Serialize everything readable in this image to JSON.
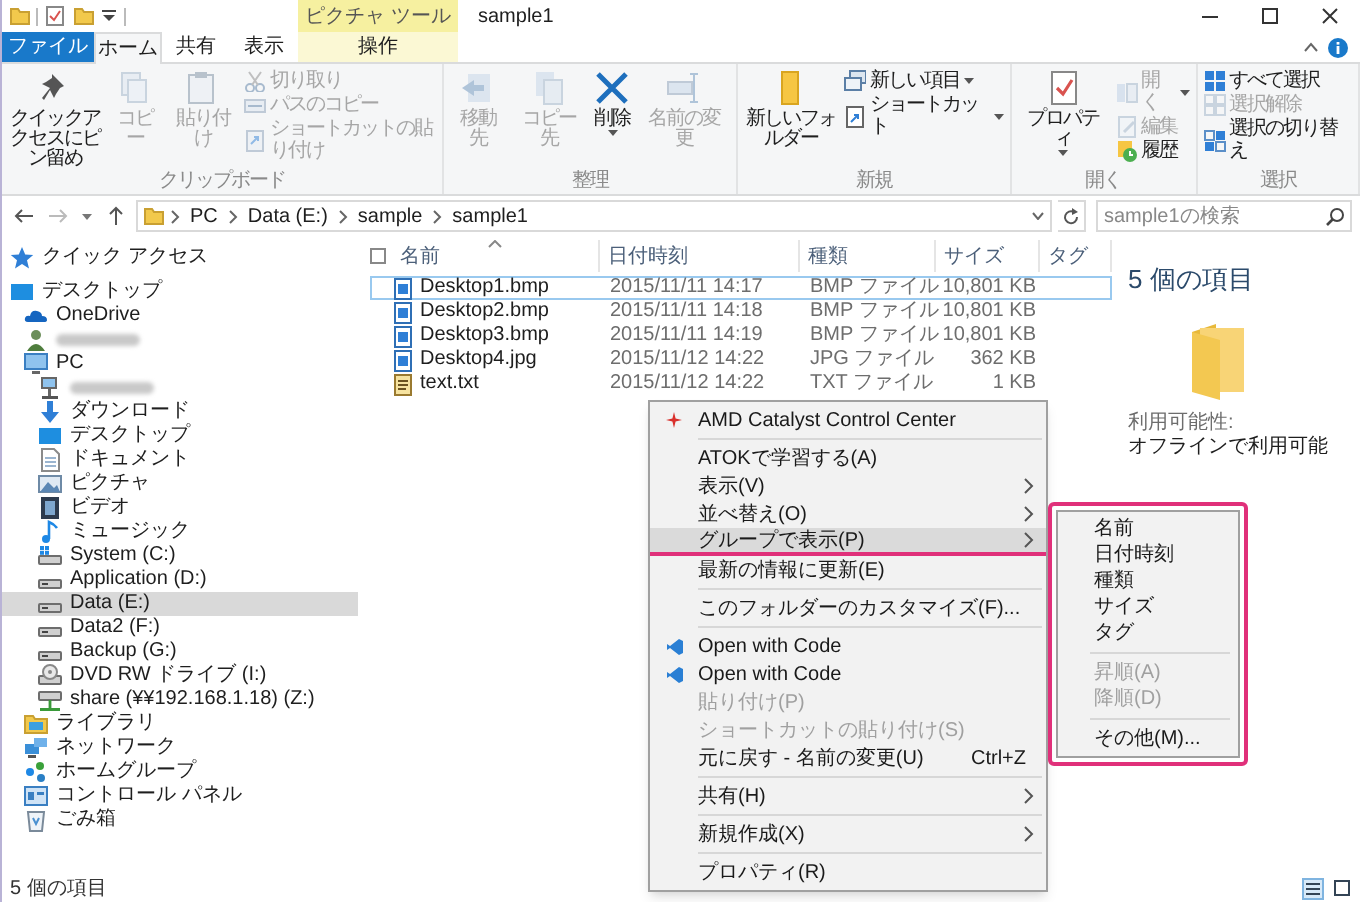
{
  "title_bar": {
    "context_tab_group": "ピクチャ ツール",
    "title": "sample1"
  },
  "tabs": [
    {
      "label": "ファイル",
      "kind": "file",
      "selected": false
    },
    {
      "label": "ホーム",
      "kind": "normal",
      "selected": true
    },
    {
      "label": "共有",
      "kind": "normal",
      "selected": false
    },
    {
      "label": "表示",
      "kind": "normal",
      "selected": false
    },
    {
      "label": "操作",
      "kind": "contextual",
      "selected": false
    }
  ],
  "ribbon": [
    {
      "label": "クリップボード",
      "buttons": [
        {
          "kind": "large",
          "label": "クイックアクセスにピン留め",
          "disabled": false
        },
        {
          "kind": "large",
          "label": "コピー",
          "disabled": true
        },
        {
          "kind": "large",
          "label": "貼り付け",
          "disabled": true
        },
        {
          "kind": "small",
          "label": "切り取り",
          "disabled": true
        },
        {
          "kind": "small",
          "label": "パスのコピー",
          "disabled": true
        },
        {
          "kind": "small",
          "label": "ショートカットの貼り付け",
          "disabled": true
        }
      ]
    },
    {
      "label": "整理",
      "buttons": [
        {
          "kind": "large",
          "label": "移動先",
          "disabled": true
        },
        {
          "kind": "large",
          "label": "コピー先",
          "disabled": true
        },
        {
          "kind": "large",
          "label": "削除",
          "disabled": false,
          "dropdown": true
        },
        {
          "kind": "large",
          "label": "名前の変更",
          "disabled": true
        }
      ]
    },
    {
      "label": "新規",
      "buttons": [
        {
          "kind": "large",
          "label": "新しいフォルダー",
          "disabled": false
        },
        {
          "kind": "small",
          "label": "新しい項目",
          "disabled": false,
          "dropdown": true
        },
        {
          "kind": "small",
          "label": "ショートカット",
          "disabled": false,
          "dropdown": true
        }
      ]
    },
    {
      "label": "開く",
      "buttons": [
        {
          "kind": "large",
          "label": "プロパティ",
          "disabled": false,
          "dropdown": true
        },
        {
          "kind": "small",
          "label": "開く",
          "disabled": true,
          "dropdown": true
        },
        {
          "kind": "small",
          "label": "編集",
          "disabled": true
        },
        {
          "kind": "small",
          "label": "履歴",
          "disabled": false
        }
      ]
    },
    {
      "label": "選択",
      "buttons": [
        {
          "kind": "small",
          "label": "すべて選択",
          "disabled": false
        },
        {
          "kind": "small",
          "label": "選択解除",
          "disabled": true
        },
        {
          "kind": "small",
          "label": "選択の切り替え",
          "disabled": false
        }
      ]
    }
  ],
  "address_bar": {
    "path": [
      "PC",
      "Data (E:)",
      "sample",
      "sample1"
    ],
    "search": {
      "placeholder": "sample1の検索"
    }
  },
  "navigation": [
    {
      "label": "クイック アクセス",
      "kind": "item",
      "selected": false
    },
    {
      "label": "デスクトップ",
      "kind": "item",
      "selected": false,
      "children": [
        {
          "label": "OneDrive",
          "kind": "item",
          "selected": false
        },
        {
          "kind": "blurred",
          "selected": false
        },
        {
          "label": "PC",
          "kind": "item",
          "selected": false,
          "children": [
            {
              "kind": "blurred",
              "selected": false
            },
            {
              "label": "ダウンロード",
              "kind": "item",
              "selected": false
            },
            {
              "label": "デスクトップ",
              "kind": "item",
              "selected": false
            },
            {
              "label": "ドキュメント",
              "kind": "item",
              "selected": false
            },
            {
              "label": "ピクチャ",
              "kind": "item",
              "selected": false
            },
            {
              "label": "ビデオ",
              "kind": "item",
              "selected": false
            },
            {
              "label": "ミュージック",
              "kind": "item",
              "selected": false
            },
            {
              "label": "System (C:)",
              "kind": "item",
              "selected": false
            },
            {
              "label": "Application (D:)",
              "kind": "item",
              "selected": false
            },
            {
              "label": "Data (E:)",
              "kind": "item",
              "selected": true
            },
            {
              "label": "Data2 (F:)",
              "kind": "item",
              "selected": false
            },
            {
              "label": "Backup (G:)",
              "kind": "item",
              "selected": false
            },
            {
              "label": "DVD RW ドライブ (I:)",
              "kind": "item",
              "selected": false
            },
            {
              "label": "share (¥¥192.168.1.18) (Z:)",
              "kind": "item",
              "selected": false
            }
          ]
        },
        {
          "label": "ライブラリ",
          "kind": "item",
          "selected": false
        },
        {
          "label": "ネットワーク",
          "kind": "item",
          "selected": false
        },
        {
          "label": "ホームグループ",
          "kind": "item",
          "selected": false
        },
        {
          "label": "コントロール パネル",
          "kind": "item",
          "selected": false
        },
        {
          "label": "ごみ箱",
          "kind": "item",
          "selected": false
        }
      ]
    }
  ],
  "file_list": {
    "select_all_checked": false,
    "columns": [
      {
        "label": "名前",
        "sorted": true
      },
      {
        "label": "日付時刻",
        "sorted": false
      },
      {
        "label": "種類",
        "sorted": false
      },
      {
        "label": "サイズ",
        "sorted": false
      },
      {
        "label": "タグ",
        "sorted": false
      }
    ],
    "rows": [
      {
        "name": "Desktop1.bmp",
        "date": "2015/11/11 14:17",
        "type": "BMP ファイル",
        "size": "10,801 KB",
        "kind": "image",
        "focused": true
      },
      {
        "name": "Desktop2.bmp",
        "date": "2015/11/11 14:18",
        "type": "BMP ファイル",
        "size": "10,801 KB",
        "kind": "image",
        "focused": false
      },
      {
        "name": "Desktop3.bmp",
        "date": "2015/11/11 14:19",
        "type": "BMP ファイル",
        "size": "10,801 KB",
        "kind": "image",
        "focused": false
      },
      {
        "name": "Desktop4.jpg",
        "date": "2015/11/12 14:22",
        "type": "JPG ファイル",
        "size": "362 KB",
        "kind": "image",
        "focused": false
      },
      {
        "name": "text.txt",
        "date": "2015/11/12 14:22",
        "type": "TXT ファイル",
        "size": "1 KB",
        "kind": "text",
        "focused": false
      }
    ]
  },
  "details_pane": {
    "summary": "5 個の項目",
    "availability_label": "利用可能性:",
    "availability_value": "オフラインで利用可能"
  },
  "context_menu": {
    "sections": [
      [
        {
          "label": "AMD Catalyst Control Center",
          "selected": false,
          "disabled": false,
          "submenu": false
        }
      ],
      [
        {
          "label": "ATOKで学習する(A)",
          "selected": false,
          "disabled": false,
          "submenu": false
        },
        {
          "label": "表示(V)",
          "selected": false,
          "disabled": false,
          "submenu": true
        },
        {
          "label": "並べ替え(O)",
          "selected": false,
          "disabled": false,
          "submenu": true
        },
        {
          "label": "グループで表示(P)",
          "selected": true,
          "disabled": false,
          "submenu": true
        },
        {
          "label": "最新の情報に更新(E)",
          "selected": false,
          "disabled": false,
          "submenu": false
        }
      ],
      [
        {
          "label": "このフォルダーのカスタマイズ(F)...",
          "selected": false,
          "disabled": false,
          "submenu": false
        }
      ],
      [
        {
          "label": "Open with Code",
          "selected": false,
          "disabled": false,
          "submenu": false
        },
        {
          "label": "Open with Code",
          "selected": false,
          "disabled": false,
          "submenu": false
        },
        {
          "label": "貼り付け(P)",
          "selected": false,
          "disabled": true,
          "submenu": false
        },
        {
          "label": "ショートカットの貼り付け(S)",
          "selected": false,
          "disabled": true,
          "submenu": false
        },
        {
          "label": "元に戻す - 名前の変更(U)",
          "shortcut": "Ctrl+Z",
          "selected": false,
          "disabled": false,
          "submenu": false
        }
      ],
      [
        {
          "label": "共有(H)",
          "selected": false,
          "disabled": false,
          "submenu": true
        }
      ],
      [
        {
          "label": "新規作成(X)",
          "selected": false,
          "disabled": false,
          "submenu": true
        }
      ],
      [
        {
          "label": "プロパティ(R)",
          "selected": false,
          "disabled": false,
          "submenu": false
        }
      ]
    ]
  },
  "submenu": {
    "sections": [
      [
        {
          "label": "名前",
          "disabled": false
        },
        {
          "label": "日付時刻",
          "disabled": false
        },
        {
          "label": "種類",
          "disabled": false
        },
        {
          "label": "サイズ",
          "disabled": false
        },
        {
          "label": "タグ",
          "disabled": false
        }
      ],
      [
        {
          "label": "昇順(A)",
          "disabled": true
        },
        {
          "label": "降順(D)",
          "disabled": true
        }
      ],
      [
        {
          "label": "その他(M)...",
          "disabled": false
        }
      ]
    ]
  },
  "status_bar": {
    "item_count": "5 個の項目"
  }
}
